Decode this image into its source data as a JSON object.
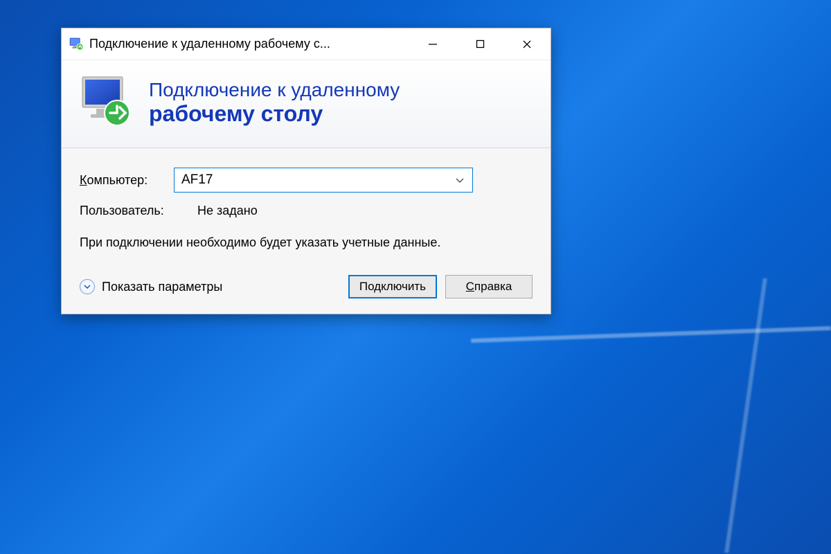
{
  "window": {
    "title": "Подключение к удаленному рабочему с..."
  },
  "header": {
    "line1": "Подключение к удаленному",
    "line2": "рабочему столу"
  },
  "form": {
    "computer_label": "Компьютер:",
    "computer_value": "AF17",
    "user_label": "Пользователь:",
    "user_value": "Не задано",
    "hint": "При подключении необходимо будет указать учетные данные."
  },
  "footer": {
    "show_params": "Показать параметры",
    "connect": "Подключить",
    "help": "Справка",
    "help_ul_char": "С",
    "help_rest": "правка"
  }
}
